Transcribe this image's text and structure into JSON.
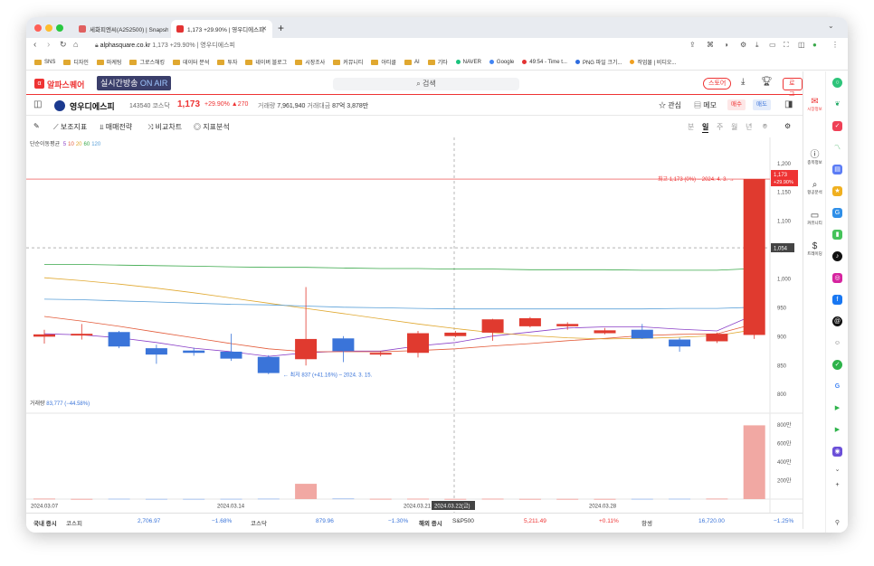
{
  "browser": {
    "tabs": [
      {
        "title": "세화피엔씨(A252500) | Snapsho",
        "color": "#e06060"
      },
      {
        "title": "1,173 +29.90% | 영우디에스피",
        "color": "#e33333"
      }
    ],
    "url_host": "alphasquare.co.kr",
    "url_title": "1,173 +29.90% | 영우디에스피",
    "bookmarks": [
      {
        "label": "SNS",
        "type": "folder"
      },
      {
        "label": "디자인",
        "type": "folder"
      },
      {
        "label": "마케팅",
        "type": "folder"
      },
      {
        "label": "그로스해킹",
        "type": "folder"
      },
      {
        "label": "데이터 분석",
        "type": "folder"
      },
      {
        "label": "투자",
        "type": "folder"
      },
      {
        "label": "네이버 블로그",
        "type": "folder"
      },
      {
        "label": "시장조사",
        "type": "folder"
      },
      {
        "label": "커뮤니티",
        "type": "folder"
      },
      {
        "label": "아티클",
        "type": "folder"
      },
      {
        "label": "AI",
        "type": "folder"
      },
      {
        "label": "기타",
        "type": "folder"
      },
      {
        "label": "NAVER",
        "type": "site",
        "color": "#19c37d"
      },
      {
        "label": "Google",
        "type": "site",
        "color": "#4285f4"
      },
      {
        "label": "49:54 - Time t...",
        "type": "site",
        "color": "#e33333"
      },
      {
        "label": "PNG 파일 크기...",
        "type": "site",
        "color": "#2d6cdf"
      },
      {
        "label": "작업물 | 비디오...",
        "type": "site",
        "color": "#f0a020"
      }
    ]
  },
  "site": {
    "logo": "알파스퀘어",
    "onair_prefix": "실시간방송",
    "onair_suffix": "ON AIR",
    "search_placeholder": "검색",
    "store_label": "스토어",
    "login_label": "로그인"
  },
  "stock": {
    "name": "영우디에스피",
    "code": "143540",
    "market": "코스닥",
    "price": "1,173",
    "change_pct": "+29.90%",
    "change_amt": "▲270",
    "volume_label": "거래량",
    "volume": "7,961,940",
    "value_label": "거래대금",
    "value": "87억 3,878만",
    "watch_label": "관심",
    "memo_label": "메모",
    "buy_label": "매수",
    "sell_label": "매도"
  },
  "tools": {
    "indicator": "보조지표",
    "strategy": "매매전략",
    "compare": "비교차트",
    "analysis": "지표분석",
    "periods": [
      "분",
      "일",
      "주",
      "월",
      "년"
    ],
    "selected_period": "일"
  },
  "chart_data": {
    "type": "candlestick",
    "ma_legend": {
      "label": "단순이동평균",
      "periods": [
        "5",
        "10",
        "20",
        "60",
        "120"
      ],
      "colors": [
        "#8a3fc7",
        "#e35b3a",
        "#e0a830",
        "#3aa84a",
        "#5aa0d8"
      ]
    },
    "ylim": [
      780,
      1220
    ],
    "yticks": [
      "1,200",
      "1,150",
      "1,100",
      "1,050",
      "1,000",
      "950",
      "900",
      "850",
      "800"
    ],
    "candles": [
      {
        "o": 900,
        "c": 904,
        "h": 912,
        "l": 888
      },
      {
        "o": 902,
        "c": 905,
        "h": 922,
        "l": 895
      },
      {
        "o": 908,
        "c": 883,
        "h": 910,
        "l": 880
      },
      {
        "o": 880,
        "c": 869,
        "h": 886,
        "l": 853
      },
      {
        "o": 876,
        "c": 872,
        "h": 881,
        "l": 867
      },
      {
        "o": 874,
        "c": 862,
        "h": 905,
        "l": 858
      },
      {
        "o": 865,
        "c": 837,
        "h": 868,
        "l": 835
      },
      {
        "o": 861,
        "c": 896,
        "h": 986,
        "l": 850
      },
      {
        "o": 897,
        "c": 875,
        "h": 901,
        "l": 856
      },
      {
        "o": 869,
        "c": 872,
        "h": 875,
        "l": 866
      },
      {
        "o": 872,
        "c": 906,
        "h": 910,
        "l": 864
      },
      {
        "o": 901,
        "c": 907,
        "h": 910,
        "l": 899
      },
      {
        "o": 907,
        "c": 930,
        "h": 931,
        "l": 893
      },
      {
        "o": 918,
        "c": 932,
        "h": 934,
        "l": 916
      },
      {
        "o": 918,
        "c": 922,
        "h": 925,
        "l": 912
      },
      {
        "o": 906,
        "c": 911,
        "h": 915,
        "l": 904
      },
      {
        "o": 912,
        "c": 897,
        "h": 922,
        "l": 896
      },
      {
        "o": 895,
        "c": 883,
        "h": 898,
        "l": 874
      },
      {
        "o": 892,
        "c": 905,
        "h": 907,
        "l": 889
      },
      {
        "o": 903,
        "c": 1173,
        "h": 1173,
        "l": 896
      }
    ],
    "volumes": [
      0.6,
      0.3,
      0.5,
      0.3,
      0.3,
      0.4,
      0.6,
      16.5,
      0.8,
      0.4,
      0.5,
      0.3,
      0.5,
      0.3,
      0.3,
      0.3,
      0.4,
      0.5,
      0.6,
      79.6
    ],
    "volume_legend_label": "거래량",
    "volume_legend_value": "83,777 (−44.58%)",
    "volume_ticks": [
      "800만",
      "600만",
      "400만",
      "200만"
    ],
    "high_annotation": "최고 1,173 (0%) – 2024. 4. 3.  →",
    "low_annotation": "← 최저 837 (+41.16%) – 2024. 3. 15.",
    "price_tag": "1,173",
    "price_tag_pct": "+29.90%",
    "cross_tag": "1,054",
    "dates": [
      "2024.03.07",
      "2024.03.14",
      "2024.03.21",
      "2024.03.22(금)",
      "2024.03.28"
    ]
  },
  "sidebar": {
    "items": [
      "시장정보",
      "종목정보",
      "항공분석",
      "커뮤니티",
      "트레이딩"
    ]
  },
  "bottom": {
    "domestic_label": "국내 증시",
    "kospi_label": "코스피",
    "kospi_value": "2,706.97",
    "kospi_change": "−1.68%",
    "kosdaq_label": "코스닥",
    "kosdaq_value": "879.96",
    "kosdaq_change": "−1.30%",
    "overseas_label": "해외 증시",
    "sp_label": "S&P500",
    "sp_value": "5,211.49",
    "sp_change": "+0.11%",
    "hs_label": "항셍",
    "hs_value": "16,720.00",
    "hs_change": "−1.25%"
  }
}
